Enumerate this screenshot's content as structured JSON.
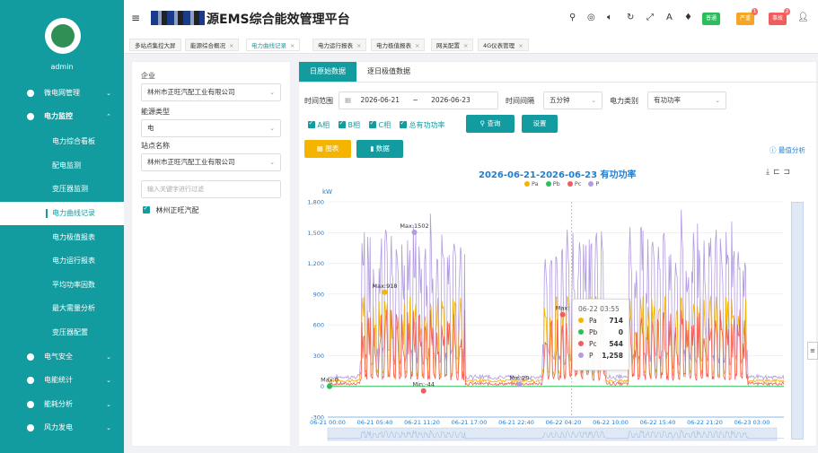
{
  "sidebar": {
    "user": "admin",
    "menu": [
      {
        "label": "微电网管理",
        "arrow": "⌄"
      },
      {
        "label": "电力监控",
        "arrow": "⌃"
      },
      {
        "label": "电气安全",
        "arrow": "⌄"
      },
      {
        "label": "电能统计",
        "arrow": "⌄"
      },
      {
        "label": "能耗分析",
        "arrow": "⌄"
      },
      {
        "label": "风力发电",
        "arrow": "⌄"
      }
    ],
    "submenu": [
      "电力综合看板",
      "配电监测",
      "变压器监测",
      "电力曲线记录",
      "电力极值报表",
      "电力运行报表",
      "平均功率因数",
      "最大需量分析",
      "变压器配置"
    ]
  },
  "header": {
    "title": "源EMS综合能效管理平台",
    "badges": [
      {
        "label": "普通",
        "color": "#2bbf5c",
        "count": ""
      },
      {
        "label": "严重",
        "color": "#f5a623",
        "count": "1"
      },
      {
        "label": "事故",
        "color": "#f25c5c",
        "count": "2"
      }
    ]
  },
  "tabs": [
    "多站点集控大屏",
    "能源综合概况",
    "电力曲线记录",
    "电力运行报表",
    "电力极值报表",
    "网关配置",
    "4G仪表管理"
  ],
  "left": {
    "company_label": "企业",
    "company": "林州市正旺汽配工业有限公司",
    "energy_label": "能源类型",
    "energy": "电",
    "station_label": "站点名称",
    "station": "林州市正旺汽配工业有限公司",
    "filter_placeholder": "输入关键字进行过滤",
    "tree_item": "林州正旺汽配"
  },
  "main": {
    "tabs": [
      "日原始数据",
      "逐日极值数据"
    ],
    "range_label": "时间范围",
    "date_start": "2026-06-21",
    "date_sep": "~",
    "date_end": "2026-06-23",
    "interval_label": "时间间隔",
    "interval": "五分钟",
    "type_label": "电力类别",
    "type": "有功功率",
    "phases": [
      "A相",
      "B相",
      "C相",
      "总有功功率"
    ],
    "query": "查询",
    "settings": "设置",
    "btn_chart": "图表",
    "btn_data": "数据",
    "extreme": "最值分析"
  },
  "chart_data": {
    "type": "line",
    "title": "2026-06-21-2026-06-23  有功功率",
    "ylabel": "kW",
    "ylim": [
      -300,
      1800
    ],
    "yticks": [
      "1,800",
      "1,500",
      "1,200",
      "900",
      "600",
      "300",
      "0",
      "-300"
    ],
    "xticks": [
      "06-21 00:00",
      "06-21 05:40",
      "06-21 11:20",
      "06-21 17:00",
      "06-21 22:40",
      "06-22 04:20",
      "06-22 10:00",
      "06-22 15:40",
      "06-22 21:20",
      "06-23 03:00"
    ],
    "series": [
      {
        "name": "Pa",
        "color": "#f5b400"
      },
      {
        "name": "Pb",
        "color": "#2bbf5c"
      },
      {
        "name": "Pc",
        "color": "#f25c5c"
      },
      {
        "name": "P",
        "color": "#b39be0"
      }
    ],
    "annotations": [
      "Max:1502",
      "Max:918",
      "Max:0",
      "Min:-44",
      "Min:20",
      "Max:"
    ],
    "tooltip": {
      "time": "06-22 03:55",
      "rows": [
        {
          "name": "Pa",
          "value": "714"
        },
        {
          "name": "Pb",
          "value": "0"
        },
        {
          "name": "Pc",
          "value": "544"
        },
        {
          "name": "P",
          "value": "1,258"
        }
      ]
    }
  }
}
